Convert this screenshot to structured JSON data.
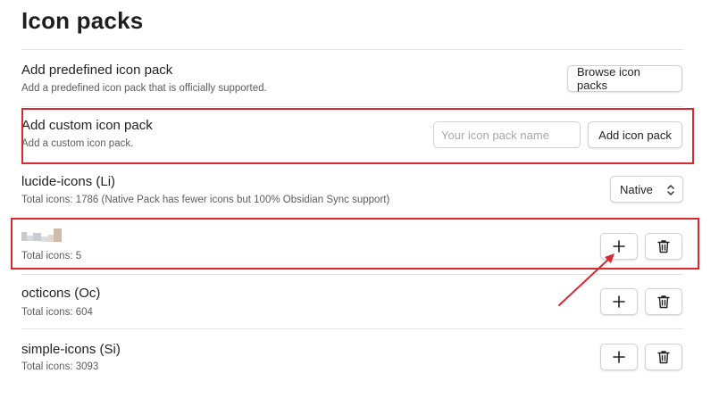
{
  "title": "Icon packs",
  "predefined": {
    "name": "Add predefined icon pack",
    "description": "Add a predefined icon pack that is officially supported.",
    "button_label": "Browse icon packs"
  },
  "custom": {
    "name": "Add custom icon pack",
    "description": "Add a custom icon pack.",
    "input_placeholder": "Your icon pack name",
    "input_value": "",
    "button_label": "Add icon pack"
  },
  "lucide": {
    "name": "lucide-icons (Li)",
    "description": "Total icons: 1786 (Native Pack has fewer icons but 100% Obsidian Sync support)",
    "select_value": "Native"
  },
  "packs": [
    {
      "name": "",
      "name_redacted": true,
      "total": "Total icons: 5",
      "add_icon": "plus-icon",
      "delete_icon": "trash-icon"
    },
    {
      "name": "octicons (Oc)",
      "total": "Total icons: 604",
      "add_icon": "plus-icon",
      "delete_icon": "trash-icon"
    },
    {
      "name": "simple-icons (Si)",
      "total": "Total icons: 3093",
      "add_icon": "plus-icon",
      "delete_icon": "trash-icon"
    }
  ],
  "colors": {
    "highlight": "#d9282f",
    "text": "#222222",
    "muted": "#5c5c5c",
    "divider": "#e3e3e3"
  }
}
